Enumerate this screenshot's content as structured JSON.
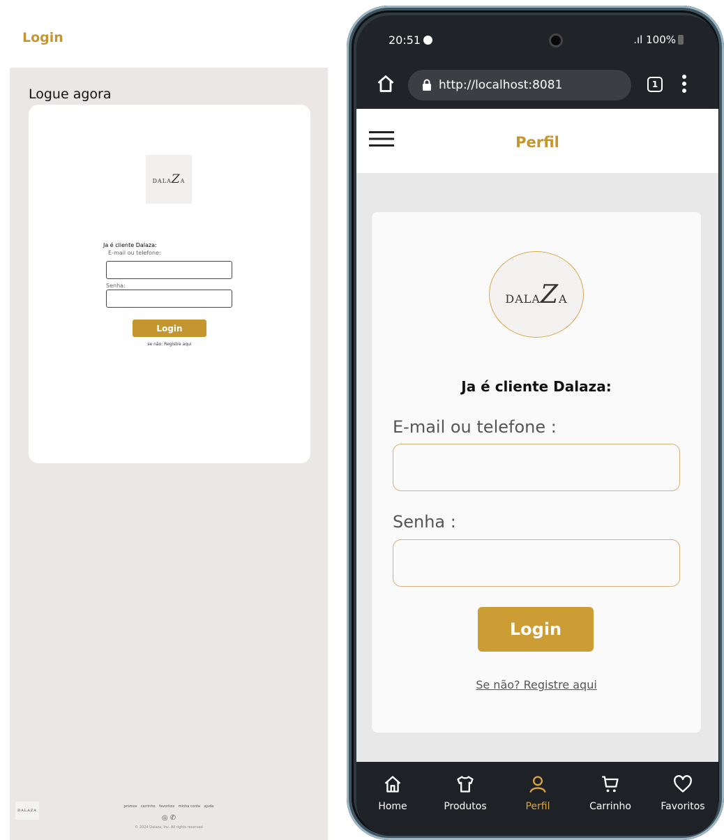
{
  "desktop": {
    "header_title": "Login",
    "section_title": "Logue agora",
    "logo_text": "DALA",
    "logo_z": "Z",
    "logo_tail": "A",
    "client_label": "Ja é cliente Dalaza:",
    "email_label": "E-mail ou telefone:",
    "password_label": "Senha:",
    "login_button": "Login",
    "register_text": "se não: Registre aqui",
    "footer_links": [
      "promos",
      "carrinho",
      "favoritos",
      "minha conta",
      "ajuda"
    ],
    "footer_social": "◎ ✆",
    "footer_copyright": "© 2024 Dalaza, Inc. All rights reserved"
  },
  "phone": {
    "status": {
      "time": "20:51",
      "signal_battery": ".ıl 100%"
    },
    "browser": {
      "url": "http://localhost:8081",
      "tab_count": "1"
    },
    "header_title": "Perfil",
    "logo_text": "DALA",
    "logo_z": "Z",
    "logo_tail": "A",
    "client_title": "Ja é cliente Dalaza:",
    "email_label": "E-mail ou telefone :",
    "password_label": "Senha :",
    "login_button": "Login",
    "register_link": "Se não? Registre aqui",
    "tabs": [
      {
        "label": "Home",
        "icon": "home-icon"
      },
      {
        "label": "Produtos",
        "icon": "shirt-icon"
      },
      {
        "label": "Perfil",
        "icon": "user-icon"
      },
      {
        "label": "Carrinho",
        "icon": "cart-icon"
      },
      {
        "label": "Favoritos",
        "icon": "heart-icon"
      }
    ],
    "active_tab": "Perfil"
  },
  "colors": {
    "accent": "#c4962f",
    "active_tab": "#d9a441",
    "input_border": "#d4b27a",
    "page_bg": "#ebe7e6",
    "dark_bar": "#1e2226"
  }
}
